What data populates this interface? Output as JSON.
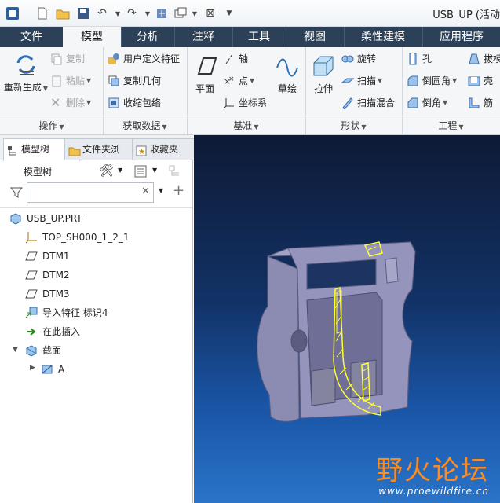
{
  "window": {
    "title": "USB_UP (活动"
  },
  "tabs": [
    {
      "label": "文件"
    },
    {
      "label": "模型"
    },
    {
      "label": "分析"
    },
    {
      "label": "注释"
    },
    {
      "label": "工具"
    },
    {
      "label": "视图"
    },
    {
      "label": "柔性建模"
    },
    {
      "label": "应用程序"
    }
  ],
  "ribbon": {
    "operations": {
      "label": "操作",
      "regen": "重新生成",
      "copy": "复制",
      "paste": "粘贴",
      "delete": "删除"
    },
    "get_data": {
      "label": "获取数据",
      "udf": "用户定义特征",
      "copy_geom": "复制几何",
      "shrinkwrap": "收缩包络"
    },
    "datum": {
      "label": "基准",
      "plane": "平面",
      "axis": "轴",
      "point": "点",
      "csys": "坐标系",
      "sketch": "草绘"
    },
    "shapes": {
      "label": "形状",
      "extrude": "拉伸",
      "revolve": "旋转",
      "sweep": "扫描",
      "swept_blend": "扫描混合"
    },
    "engineering": {
      "label": "工程",
      "hole": "孔",
      "round": "倒圆角",
      "chamfer": "倒角",
      "draft": "拔模",
      "shell": "壳",
      "rib": "筋"
    }
  },
  "panel": {
    "tabs": [
      {
        "label": "模型树"
      },
      {
        "label": "文件夹浏"
      },
      {
        "label": "收藏夹"
      }
    ],
    "toolbar_title": "模型树",
    "search_placeholder": "",
    "tree": [
      {
        "label": "USB_UP.PRT",
        "icon": "part-icon"
      },
      {
        "label": "TOP_SH000_1_2_1",
        "icon": "csys-icon"
      },
      {
        "label": "DTM1",
        "icon": "datum-plane-icon"
      },
      {
        "label": "DTM2",
        "icon": "datum-plane-icon"
      },
      {
        "label": "DTM3",
        "icon": "datum-plane-icon"
      },
      {
        "label": "导入特征 标识4",
        "icon": "import-feature-icon"
      },
      {
        "label": "在此插入",
        "icon": "insert-here-icon"
      },
      {
        "label": "截面",
        "icon": "section-icon"
      },
      {
        "label": "A",
        "icon": "section-a-icon"
      }
    ]
  },
  "watermark": {
    "cn": "野火论坛",
    "url": "www.proewildfire.cn"
  },
  "colors": {
    "tabbar": "#2c4057",
    "model": "#8a8ab0",
    "highlight": "#ffff33",
    "logo": "#ff8a1d"
  }
}
